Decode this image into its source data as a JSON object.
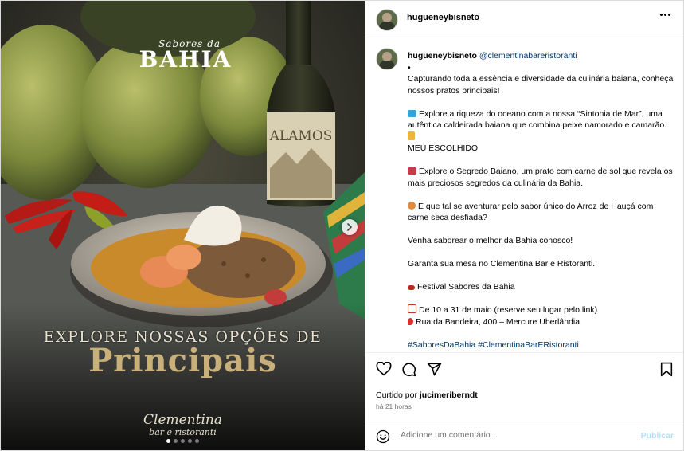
{
  "post": {
    "username": "hugueneybisneto",
    "caption_user": "hugueneybisneto",
    "mention": "@clementinabareristoranti",
    "lines": [
      "•",
      "Capturando toda a essência e diversidade da culinária baiana, conheça nossos pratos principais!",
      "",
      "Explore a riqueza do oceano com a nossa “Sintonia de Mar”, uma autêntica caldeirada baiana que combina peixe namorado e camarão.",
      "",
      "MEU ESCOLHIDO",
      "",
      "Explore o Segredo Baiano, um prato com carne de sol que revela os mais preciosos segredos da culinária da Bahia.",
      "",
      "E que tal se aventurar pelo sabor único do Arroz de Hauçá com carne seca desfiada?",
      "",
      "Venha saborear o melhor da Bahia conosco!",
      "",
      "Garanta sua mesa no Clementina Bar e Ristoranti.",
      "",
      "Festival Sabores da Bahia",
      "",
      "De 10 a 31 de maio (reserve seu lugar pelo link)",
      "Rua da Bandeira, 400 – Mercure Uberlândia",
      "",
      "#SaboresDaBahia #ClementinaBarERistoranti"
    ],
    "liked_by_prefix": "Curtido por",
    "liked_by_user": "jucimeriberndt",
    "time": "há 21 horas",
    "comment_placeholder": "Adicione um comentário...",
    "publish_label": "Publicar"
  },
  "media": {
    "brand_small": "Sabores da",
    "brand_big": "BAHIA",
    "wine_label": "ALAMOS",
    "headline_1": "EXPLORE NOSSAS OPÇÕES DE",
    "headline_2": "Principais",
    "restaurant_name": "Clementina",
    "restaurant_sub": "bar e ristoranti",
    "carousel_count": 5,
    "carousel_active": 1
  },
  "colors": {
    "link": "#00376b",
    "muted": "#737373",
    "publish_disabled": "#b2dffc"
  },
  "icons": [
    "more-icon",
    "next-arrow-icon",
    "heart-icon",
    "comment-icon",
    "share-icon",
    "bookmark-icon",
    "emoji-icon",
    "fish-emoji",
    "pointing-hand-emoji",
    "steak-emoji",
    "rice-emoji",
    "pepper-emoji",
    "calendar-emoji",
    "pin-emoji"
  ]
}
